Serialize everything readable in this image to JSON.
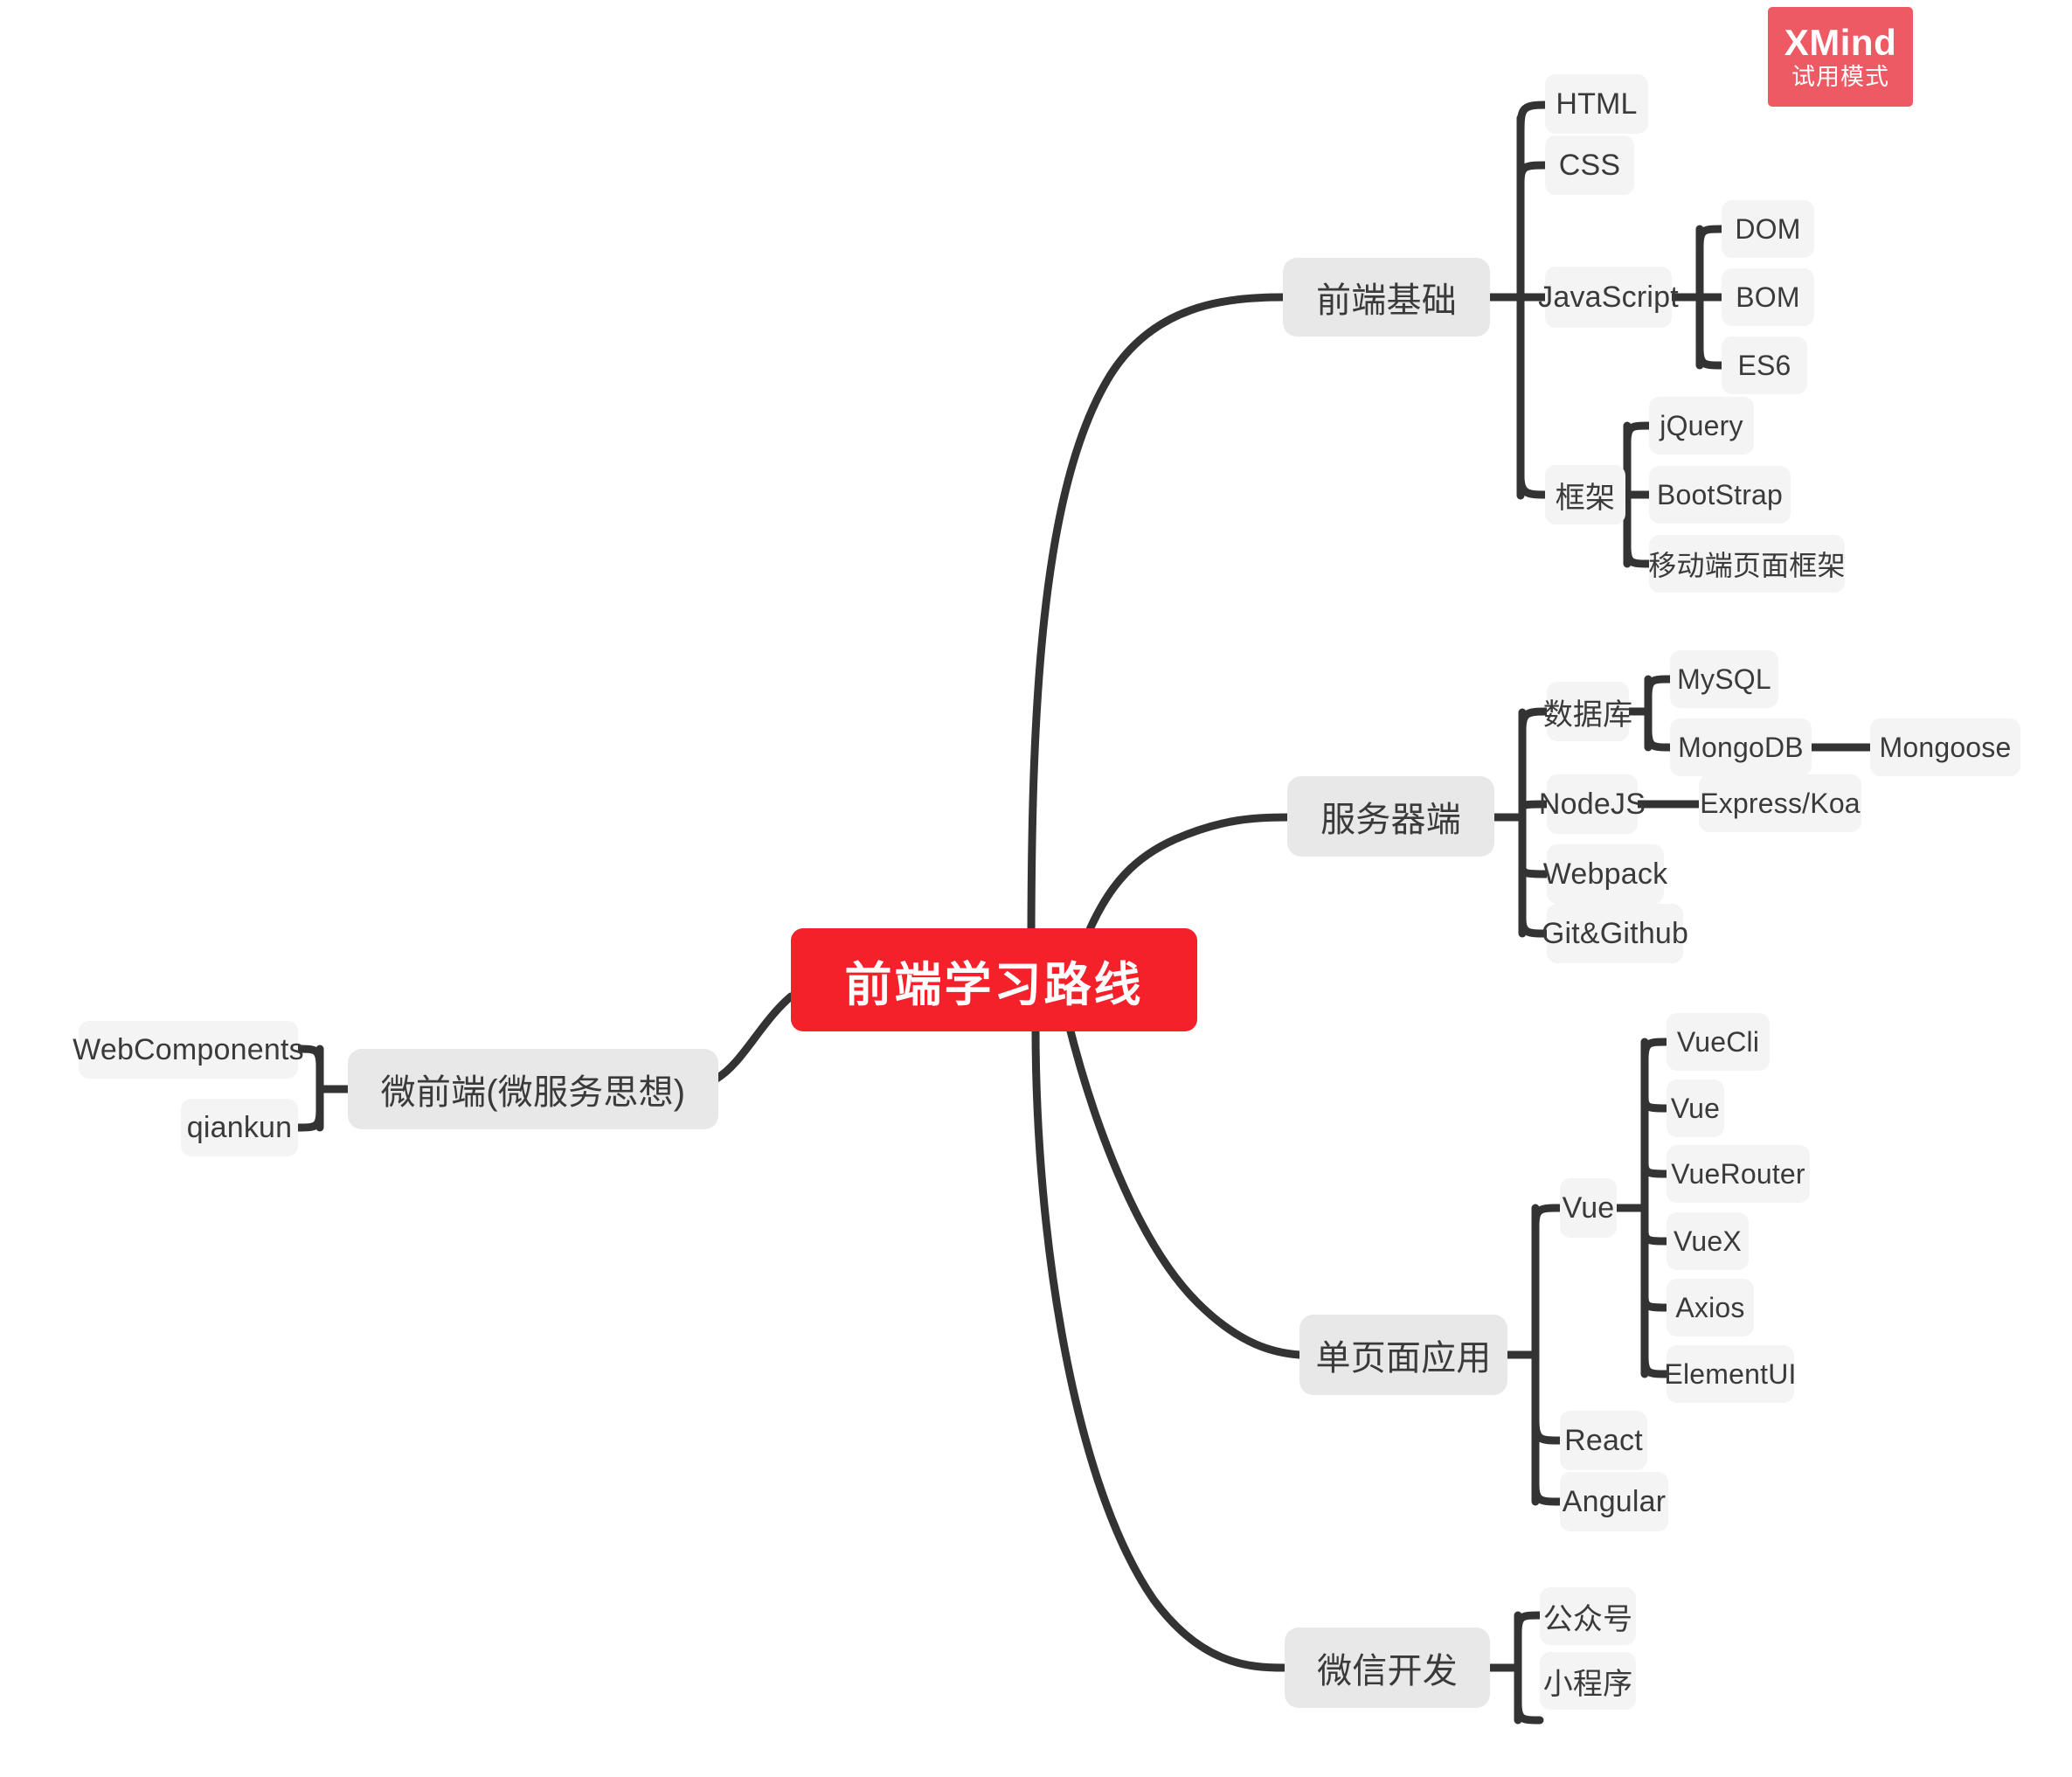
{
  "watermark": {
    "title": "XMind",
    "subtitle": "试用模式",
    "color": "#EE5A63"
  },
  "theme": {
    "root_bg": "#F4212B",
    "root_text": "#FFFFFF",
    "level1_bg": "#E8E8E8",
    "level2_bg": "#F4F4F4",
    "level3_bg": "#F4F4F4",
    "text": "#3A3A3A",
    "line": "#333333",
    "canvas_bg": "#FFFFFF"
  },
  "mindmap": {
    "root": "前端学习路线",
    "branches": {
      "frontend_basics": {
        "label": "前端基础",
        "children": {
          "html": "HTML",
          "css": "CSS",
          "javascript": "JavaScript",
          "js_children": {
            "dom": "DOM",
            "bom": "BOM",
            "es6": "ES6"
          },
          "framework": "框架",
          "framework_children": {
            "jquery": "jQuery",
            "bootstrap": "BootStrap",
            "mobile": "移动端页面框架"
          }
        }
      },
      "server": {
        "label": "服务器端",
        "children": {
          "database": "数据库",
          "db_children": {
            "mysql": "MySQL",
            "mongodb": "MongoDB",
            "mongoose": "Mongoose"
          },
          "nodejs": "NodeJS",
          "express": "Express/Koa",
          "webpack": "Webpack",
          "git": "Git&Github"
        }
      },
      "spa": {
        "label": "单页面应用",
        "children": {
          "vue": "Vue",
          "vue_children": {
            "vuecli": "VueCli",
            "vue": "Vue",
            "vuerouter": "VueRouter",
            "vuex": "VueX",
            "axios": "Axios",
            "elementui": "ElementUI"
          },
          "react": "React",
          "angular": "Angular"
        }
      },
      "wechat": {
        "label": "微信开发",
        "children": {
          "official": "公众号",
          "miniprogram": "小程序"
        }
      },
      "micro_frontend": {
        "label": "微前端(微服务思想)",
        "children": {
          "webcomponents": "WebComponents",
          "qiankun": "qiankun"
        }
      }
    }
  }
}
